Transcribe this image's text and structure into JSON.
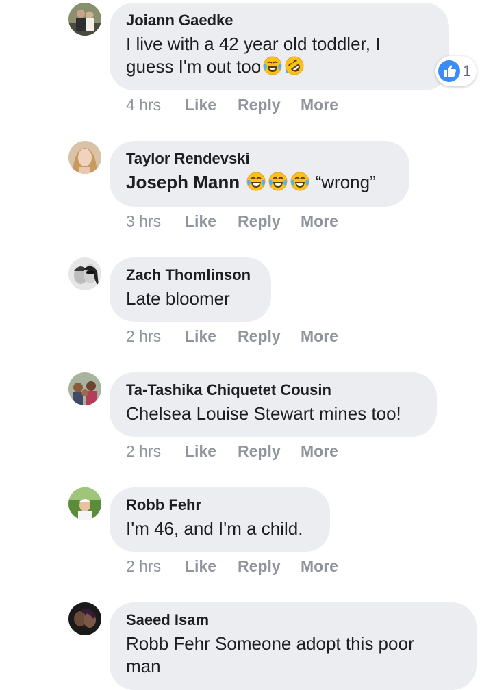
{
  "comments": [
    {
      "author": "Joiann Gaedke",
      "text_line1": "I live with a 42 year old toddler, I",
      "text_line2": "guess I'm out too",
      "emojis": [
        "tears-of-joy-emoji",
        "rolling-on-floor-laughing-emoji"
      ],
      "time": "4 hrs",
      "reaction": {
        "icon": "like-icon",
        "count": "1"
      }
    },
    {
      "author": "Taylor Rendevski",
      "mention": "Joseph Mann",
      "emojis": [
        "tears-of-joy-emoji",
        "tears-of-joy-emoji",
        "tears-of-joy-emoji"
      ],
      "text": "“wrong”",
      "time": "3 hrs"
    },
    {
      "author": "Zach Thomlinson",
      "text": "Late bloomer",
      "time": "2 hrs"
    },
    {
      "author": "Ta-Tashika Chiquetet Cousin",
      "text": "Chelsea Louise Stewart mines too!",
      "time": "2 hrs"
    },
    {
      "author": "Robb Fehr",
      "text": "I'm 46, and I'm a child.",
      "time": "2 hrs"
    },
    {
      "author": "Saeed Isam",
      "text_line1": "Robb Fehr Someone adopt this poor",
      "text_line2": "man"
    }
  ],
  "actions": {
    "like": "Like",
    "reply": "Reply",
    "more": "More"
  },
  "colors": {
    "bubble": "#ebedf0",
    "meta_text": "#90949c",
    "like_blue": "#3b8cf6",
    "emoji_yellow": "#fcc21b"
  }
}
